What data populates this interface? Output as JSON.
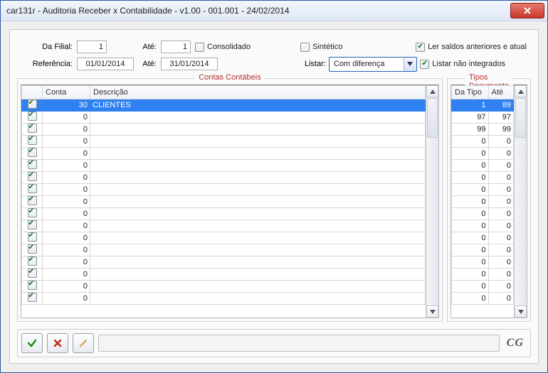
{
  "window": {
    "title": "car131r - Auditoria Receber x Contabilidade - v1.00 - 001.001 - 24/02/2014"
  },
  "params": {
    "da_filial_label": "Da Filial:",
    "da_filial_value": "1",
    "ate1_label": "Até:",
    "ate1_value": "1",
    "consolidado_label": "Consolidado",
    "consolidado_checked": false,
    "sintetico_label": "Sintético",
    "sintetico_checked": false,
    "ler_saldos_label": "Ler saldos anteriores e atual",
    "ler_saldos_checked": true,
    "referencia_label": "Referência:",
    "referencia_value": "01/01/2014",
    "ate2_label": "Até:",
    "ate2_value": "31/01/2014",
    "listar_label": "Listar:",
    "listar_value": "Com diferença",
    "nao_integrados_label": "Listar não integrados",
    "nao_integrados_checked": true
  },
  "groups": {
    "contas_title": "Contas Contábeis",
    "tipos_title": "Tipos Documento"
  },
  "contas": {
    "col_conta": "Conta",
    "col_descricao": "Descrição",
    "rows": [
      {
        "checked": true,
        "conta": "30",
        "descricao": "CLIENTES",
        "selected": true
      },
      {
        "checked": true,
        "conta": "0",
        "descricao": ""
      },
      {
        "checked": true,
        "conta": "0",
        "descricao": ""
      },
      {
        "checked": true,
        "conta": "0",
        "descricao": ""
      },
      {
        "checked": true,
        "conta": "0",
        "descricao": ""
      },
      {
        "checked": true,
        "conta": "0",
        "descricao": ""
      },
      {
        "checked": true,
        "conta": "0",
        "descricao": ""
      },
      {
        "checked": true,
        "conta": "0",
        "descricao": ""
      },
      {
        "checked": true,
        "conta": "0",
        "descricao": ""
      },
      {
        "checked": true,
        "conta": "0",
        "descricao": ""
      },
      {
        "checked": true,
        "conta": "0",
        "descricao": ""
      },
      {
        "checked": true,
        "conta": "0",
        "descricao": ""
      },
      {
        "checked": true,
        "conta": "0",
        "descricao": ""
      },
      {
        "checked": true,
        "conta": "0",
        "descricao": ""
      },
      {
        "checked": true,
        "conta": "0",
        "descricao": ""
      },
      {
        "checked": true,
        "conta": "0",
        "descricao": ""
      },
      {
        "checked": true,
        "conta": "0",
        "descricao": ""
      }
    ]
  },
  "tipos": {
    "col_da": "Da Tipo",
    "col_ate": "Até",
    "rows": [
      {
        "da": "1",
        "ate": "89",
        "selected": true
      },
      {
        "da": "97",
        "ate": "97"
      },
      {
        "da": "99",
        "ate": "99"
      },
      {
        "da": "0",
        "ate": "0"
      },
      {
        "da": "0",
        "ate": "0"
      },
      {
        "da": "0",
        "ate": "0"
      },
      {
        "da": "0",
        "ate": "0"
      },
      {
        "da": "0",
        "ate": "0"
      },
      {
        "da": "0",
        "ate": "0"
      },
      {
        "da": "0",
        "ate": "0"
      },
      {
        "da": "0",
        "ate": "0"
      },
      {
        "da": "0",
        "ate": "0"
      },
      {
        "da": "0",
        "ate": "0"
      },
      {
        "da": "0",
        "ate": "0"
      },
      {
        "da": "0",
        "ate": "0"
      },
      {
        "da": "0",
        "ate": "0"
      },
      {
        "da": "0",
        "ate": "0"
      }
    ]
  },
  "footer": {
    "logo": "CG"
  }
}
